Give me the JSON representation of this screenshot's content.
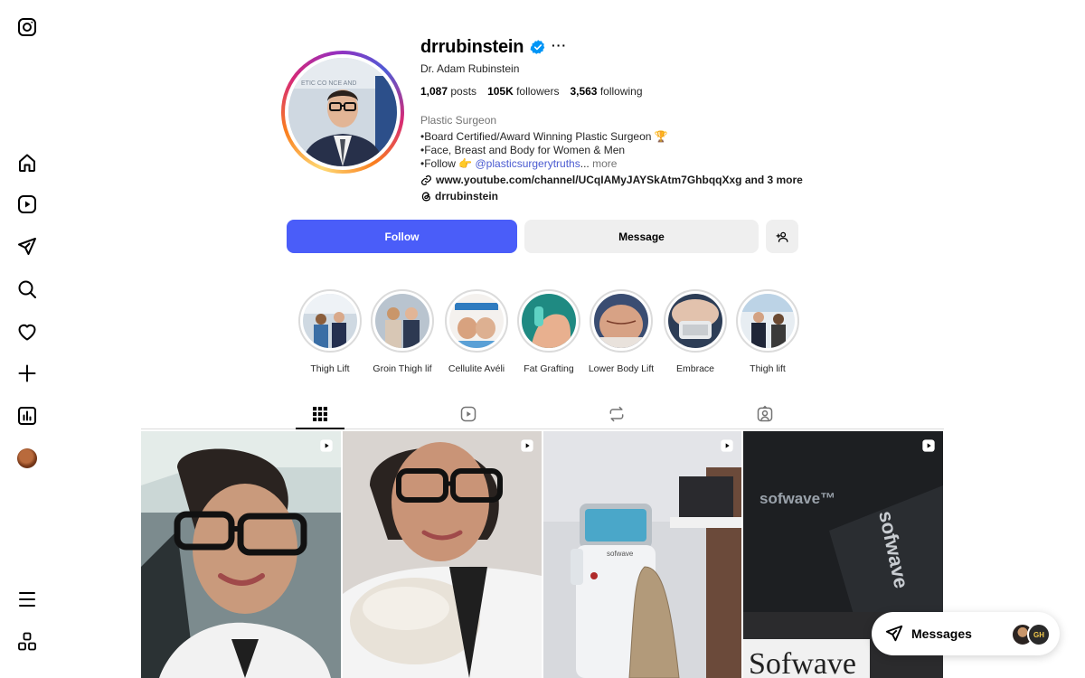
{
  "nav": {
    "items": [
      {
        "name": "instagram-logo-icon"
      },
      {
        "name": "home-icon"
      },
      {
        "name": "reels-icon"
      },
      {
        "name": "messages-icon"
      },
      {
        "name": "search-icon"
      },
      {
        "name": "notifications-icon"
      },
      {
        "name": "create-icon"
      },
      {
        "name": "insights-icon"
      },
      {
        "name": "profile-avatar-icon"
      },
      {
        "name": "menu-icon"
      },
      {
        "name": "apps-icon"
      }
    ]
  },
  "profile": {
    "username": "drrubinstein",
    "verified": true,
    "more": "···",
    "full_name": "Dr. Adam Rubinstein",
    "stats": {
      "posts_count": "1,087",
      "posts_label": "posts",
      "followers_count": "105K",
      "followers_label": "followers",
      "following_count": "3,563",
      "following_label": "following"
    },
    "category": "Plastic Surgeon",
    "bio": {
      "line1": "•Board Certified/Award Winning Plastic Surgeon 🏆",
      "line2": "•Face, Breast and Body for Women & Men",
      "line3_prefix": "•Follow 👉 ",
      "line3_mention": "@plasticsurgerytruths",
      "line3_ellipsis": "...",
      "line3_more": " more"
    },
    "link": "www.youtube.com/channel/UCqIAMyJAYSkAtm7GhbqqXxg and 3 more",
    "threads": "drrubinstein"
  },
  "actions": {
    "follow": "Follow",
    "message": "Message"
  },
  "highlights": [
    {
      "label": "Thigh Lift"
    },
    {
      "label": "Groin Thigh lif"
    },
    {
      "label": "Cellulite Avéli"
    },
    {
      "label": "Fat Grafting"
    },
    {
      "label": "Lower Body Lift"
    },
    {
      "label": "Embrace"
    },
    {
      "label": "Thigh lift"
    }
  ],
  "tabs": [
    {
      "name": "posts-grid",
      "active": true
    },
    {
      "name": "reels",
      "active": false
    },
    {
      "name": "reposts",
      "active": false
    },
    {
      "name": "tagged",
      "active": false
    }
  ],
  "posts": [
    {
      "type": "reel"
    },
    {
      "type": "reel"
    },
    {
      "type": "reel",
      "text": "sofwave"
    },
    {
      "type": "reel",
      "text_a": "sofwave™",
      "text_b": "sofwave",
      "text_c": "Sofwave"
    }
  ],
  "messages": {
    "label": "Messages",
    "avatar_initials": "GH"
  },
  "colors": {
    "follow_button": "#4a5df9",
    "verified_badge": "#0095f6",
    "mention_link": "#4a5ad0"
  }
}
